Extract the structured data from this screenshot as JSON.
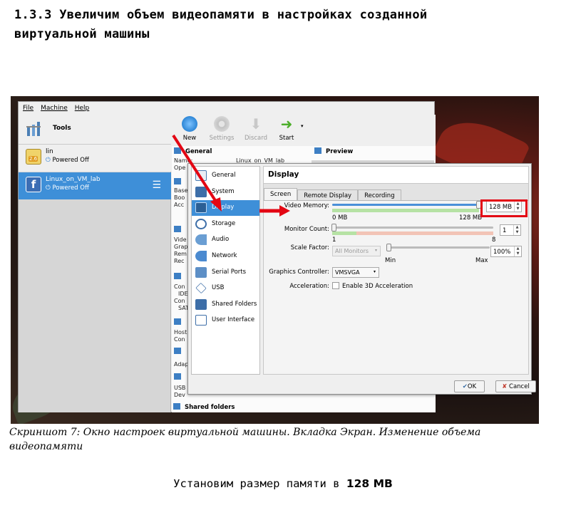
{
  "heading": {
    "line1": "1.3.3 Увеличим объем видеопамяти в настройках созданной",
    "line2": "виртуальной машины"
  },
  "vbox": {
    "menu": [
      "File",
      "Machine",
      "Help"
    ],
    "tools_label": "Tools",
    "vms": [
      {
        "name": "lin",
        "state": "Powered Off",
        "badge": "2.6"
      },
      {
        "name": "Linux_on_VM_lab",
        "state": "Powered Off"
      }
    ],
    "toolbar": {
      "new": "New",
      "settings": "Settings",
      "discard": "Discard",
      "start": "Start"
    },
    "details": {
      "general": "General",
      "preview": "Preview",
      "name_frag": "Name:",
      "name_value_frag": "Linux_on_VM_lab",
      "os_frag": "Ope",
      "system_frag": [
        "Base",
        "Boo",
        "Acc"
      ],
      "display_frag": [
        "Vide",
        "Grap",
        "Rem",
        "Rec"
      ],
      "storage_frag": [
        "Con",
        "IDE",
        "Con",
        "SAT"
      ],
      "audio_frag": [
        "Host",
        "Con"
      ],
      "network_frag": "Adap",
      "usb_frag": [
        "USB",
        "Dev"
      ],
      "shared_folders": "Shared folders"
    }
  },
  "dialog": {
    "categories": [
      "General",
      "System",
      "Display",
      "Storage",
      "Audio",
      "Network",
      "Serial Ports",
      "USB",
      "Shared Folders",
      "User Interface"
    ],
    "selected_category": "Display",
    "title": "Display",
    "tabs": [
      "Screen",
      "Remote Display",
      "Recording"
    ],
    "video_memory": {
      "label": "Video Memory:",
      "value": "128 MB",
      "min": "0 MB",
      "max": "128 MB",
      "fraction": 1.0
    },
    "monitor_count": {
      "label": "Monitor Count:",
      "value": "1",
      "min": "1",
      "max": "8",
      "fraction": 0.0
    },
    "scale_factor": {
      "label": "Scale Factor:",
      "combo": "All Monitors",
      "value": "100%",
      "min": "Min",
      "max": "Max",
      "fraction": 0.0
    },
    "graphics_controller": {
      "label": "Graphics Controller:",
      "value": "VMSVGA"
    },
    "acceleration": {
      "label": "Acceleration:",
      "checkbox": "Enable 3D Acceleration",
      "checked": false
    },
    "buttons": {
      "ok": "OK",
      "cancel": "Cancel"
    }
  },
  "caption": "Скриншот 7: Окно настроек виртуальной машины. Вкладка Экран. Изменение объема видеопамяти",
  "bottom": {
    "prefix": "Установим размер памяти в",
    "value": "128 MB"
  },
  "colors": {
    "selection": "#3e8fd8",
    "highlight": "#e30613"
  }
}
